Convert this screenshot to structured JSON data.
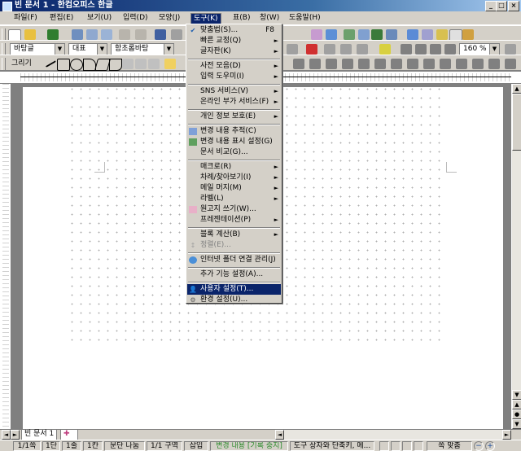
{
  "window": {
    "title": "빈 문서 1 - 한컴오피스 한글",
    "minimize_label": "_",
    "maximize_label": "□",
    "close_label": "×"
  },
  "menubar": [
    {
      "label": "파일(F)"
    },
    {
      "label": "편집(E)"
    },
    {
      "label": "보기(U)"
    },
    {
      "label": "입력(D)"
    },
    {
      "label": "모양(J)"
    },
    {
      "label": "도구(K)",
      "active": true
    },
    {
      "label": "표(B)"
    },
    {
      "label": "창(W)"
    },
    {
      "label": "도움말(H)"
    }
  ],
  "format_toolbar": {
    "style": "바탕글",
    "language": "대표",
    "font": "함초롬바탕",
    "zoom": "160 %"
  },
  "draw_toolbar": {
    "label": "그리기"
  },
  "tools_menu": {
    "items": [
      {
        "label": "맞춤법(S)...",
        "shortcut": "F8",
        "icon": "check-icon"
      },
      {
        "label": "빠른 교정(Q)",
        "submenu": true
      },
      {
        "label": "글자판(K)",
        "submenu": true
      },
      {
        "separator": true
      },
      {
        "label": "사전 모음(D)",
        "submenu": true
      },
      {
        "label": "입력 도우미(I)",
        "submenu": true
      },
      {
        "separator": true
      },
      {
        "label": "SNS 서비스(V)",
        "submenu": true
      },
      {
        "label": "온라인 부가 서비스(F)",
        "submenu": true
      },
      {
        "separator": true
      },
      {
        "label": "개인 정보 보호(E)",
        "submenu": true
      },
      {
        "separator": true
      },
      {
        "label": "변경 내용 추적(C)",
        "icon": "track-changes-icon"
      },
      {
        "label": "변경 내용 표시 설정(G)",
        "icon": "track-settings-icon"
      },
      {
        "label": "문서 비교(G)..."
      },
      {
        "separator": true
      },
      {
        "label": "매크로(R)",
        "submenu": true
      },
      {
        "label": "차례/찾아보기(I)",
        "submenu": true
      },
      {
        "label": "메일 머지(M)",
        "submenu": true
      },
      {
        "label": "라벨(L)",
        "submenu": true
      },
      {
        "label": "원고지 쓰기(W)...",
        "icon": "manuscript-icon"
      },
      {
        "label": "프레젠테이션(P)",
        "submenu": true
      },
      {
        "separator": true
      },
      {
        "label": "블록 계산(B)",
        "submenu": true
      },
      {
        "label": "정렬(E)...",
        "disabled": true,
        "icon": "sort-icon"
      },
      {
        "separator": true
      },
      {
        "label": "인터넷 폴더 연결 관리(J)",
        "icon": "internet-folder-icon"
      },
      {
        "separator": true
      },
      {
        "label": "추가 기능 설정(A)..."
      },
      {
        "separator": true
      },
      {
        "label": "사용자 설정(T)...",
        "selected": true,
        "icon": "user-settings-icon"
      },
      {
        "label": "환경 설정(U)...",
        "icon": "preferences-icon"
      }
    ]
  },
  "tabs": [
    {
      "label": "빈 문서 1"
    }
  ],
  "statusbar": [
    {
      "label": "1/1쪽"
    },
    {
      "label": "1단"
    },
    {
      "label": "1줄"
    },
    {
      "label": "1칸"
    },
    {
      "label": "문단 나눔"
    },
    {
      "label": "1/1 구역"
    },
    {
      "label": "삽입"
    },
    {
      "label": "변경 내용 [기록 중지]",
      "accent": "#2e8b2e"
    },
    {
      "label": "도구 상자와 단축키, 메..."
    },
    {
      "label": "쪽 맞춤"
    }
  ],
  "colors": {
    "titlebar": "#0a246a",
    "selection": "#0a246a",
    "chrome": "#d4d0c8"
  }
}
